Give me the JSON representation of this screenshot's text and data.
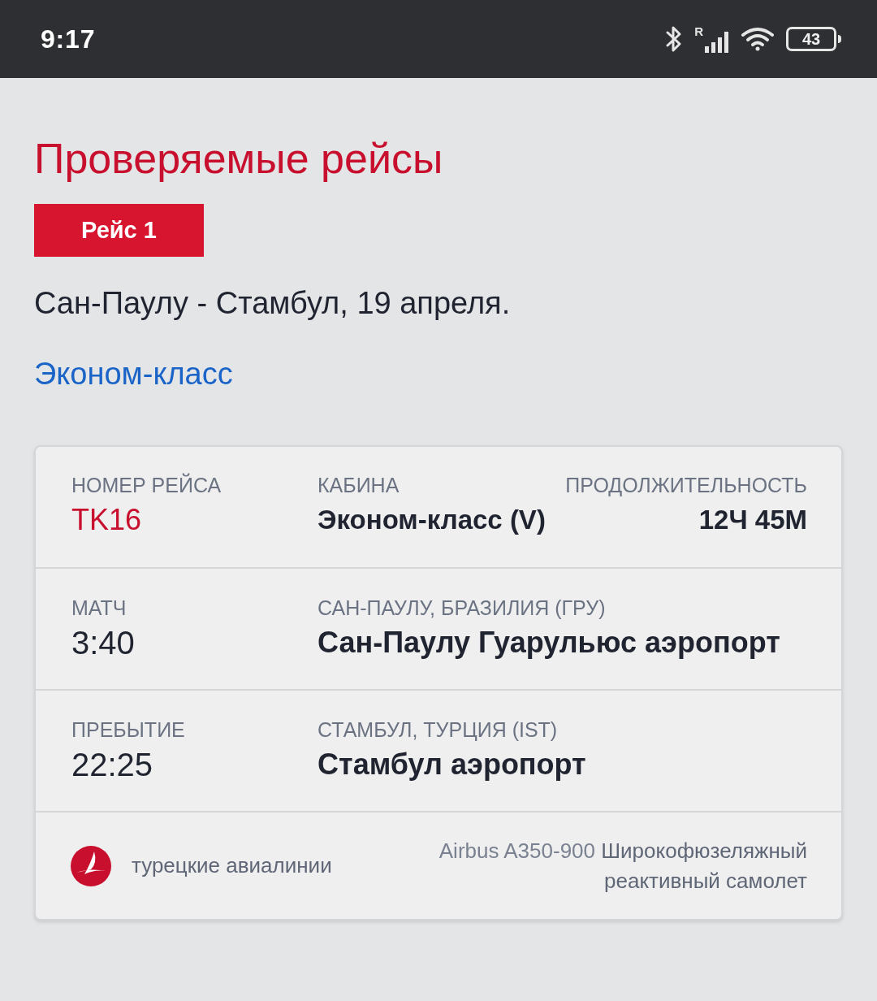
{
  "status_bar": {
    "time": "9:17",
    "signal_label": "R",
    "battery": "43"
  },
  "page": {
    "title": "Проверяемые рейсы",
    "flight_badge": "Рейс 1",
    "route": "Сан-Паулу - Стамбул, 19 апреля.",
    "cabin_link": "Эконом-класс"
  },
  "card": {
    "summary": [
      {
        "label": "НОМЕР РЕЙСА",
        "value": "TK16",
        "kind": "highlight"
      },
      {
        "label": "КАБИНА",
        "value": "Эконом-класс (V)",
        "kind": "normal"
      },
      {
        "label": "ПРОДОЛЖИТЕЛЬНОСТЬ",
        "value": "12Ч 45М",
        "kind": "normal"
      }
    ],
    "legs": [
      {
        "label": "МАТЧ",
        "time": "3:40",
        "place": "САН-ПАУЛУ, БРАЗИЛИЯ (ГРУ)",
        "airport": "Сан-Паулу Гуарульюс аэропорт"
      },
      {
        "label": "ПРЕБЫТИЕ",
        "time": "22:25",
        "place": "СТАМБУЛ, ТУРЦИЯ (IST)",
        "airport": "Стамбул аэропорт"
      }
    ],
    "footer": {
      "airline": "турецкие авиалинии",
      "aircraft_model": "Airbus A350-900",
      "aircraft_type": "Широкофюзеляжный реактивный самолет"
    }
  }
}
